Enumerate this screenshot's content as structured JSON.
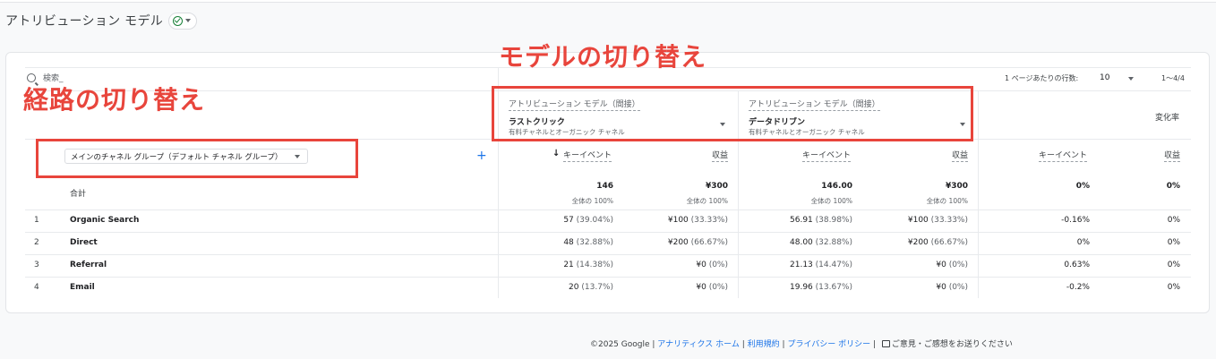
{
  "page": {
    "title": "アトリビューション モデル"
  },
  "toolbar": {
    "search_placeholder": "検索_",
    "rows_label": "1 ページあたりの行数:",
    "rows_value": "10",
    "range": "1〜4/4"
  },
  "models": [
    {
      "label": "アトリビューション モデル（間接）",
      "value": "ラストクリック",
      "sub": "有料チャネルとオーガニック チャネル"
    },
    {
      "label": "アトリビューション モデル（間接）",
      "value": "データドリブン",
      "sub": "有料チャネルとオーガニック チャネル"
    }
  ],
  "change_header": "変化率",
  "dimension": {
    "label": "メインのチャネル グループ（デフォルト チャネル グループ）"
  },
  "metrics": {
    "key_event": "キーイベント",
    "revenue": "収益"
  },
  "totals": {
    "label": "合計",
    "m1_ke": "146",
    "m1_ke_sub": "全体の 100%",
    "m1_rev": "¥300",
    "m1_rev_sub": "全体の 100%",
    "m2_ke": "146.00",
    "m2_ke_sub": "全体の 100%",
    "m2_rev": "¥300",
    "m2_rev_sub": "全体の 100%",
    "chg_ke": "0%",
    "chg_rev": "0%"
  },
  "rows": [
    {
      "idx": "1",
      "name": "Organic Search",
      "m1_ke": "57",
      "m1_ke_pct": "(39.04%)",
      "m1_rev": "¥100",
      "m1_rev_pct": "(33.33%)",
      "m2_ke": "56.91",
      "m2_ke_pct": "(38.98%)",
      "m2_rev": "¥100",
      "m2_rev_pct": "(33.33%)",
      "chg_ke": "-0.16%",
      "chg_rev": "0%"
    },
    {
      "idx": "2",
      "name": "Direct",
      "m1_ke": "48",
      "m1_ke_pct": "(32.88%)",
      "m1_rev": "¥200",
      "m1_rev_pct": "(66.67%)",
      "m2_ke": "48.00",
      "m2_ke_pct": "(32.88%)",
      "m2_rev": "¥200",
      "m2_rev_pct": "(66.67%)",
      "chg_ke": "0%",
      "chg_rev": "0%"
    },
    {
      "idx": "3",
      "name": "Referral",
      "m1_ke": "21",
      "m1_ke_pct": "(14.38%)",
      "m1_rev": "¥0",
      "m1_rev_pct": "(0%)",
      "m2_ke": "21.13",
      "m2_ke_pct": "(14.47%)",
      "m2_rev": "¥0",
      "m2_rev_pct": "(0%)",
      "chg_ke": "0.63%",
      "chg_rev": "0%"
    },
    {
      "idx": "4",
      "name": "Email",
      "m1_ke": "20",
      "m1_ke_pct": "(13.7%)",
      "m1_rev": "¥0",
      "m1_rev_pct": "(0%)",
      "m2_ke": "19.96",
      "m2_ke_pct": "(13.67%)",
      "m2_rev": "¥0",
      "m2_rev_pct": "(0%)",
      "chg_ke": "-0.2%",
      "chg_rev": "0%"
    }
  ],
  "annotations": {
    "model_switch": "モデルの切り替え",
    "path_switch": "経路の切り替え",
    "color": "#e8453c"
  },
  "footer": {
    "copyright": "©2025 Google |",
    "home": "アナリティクス ホーム",
    "terms": "利用規約",
    "privacy": "プライバシー ポリシー",
    "feedback": "ご意見・ご感想をお送りください"
  }
}
